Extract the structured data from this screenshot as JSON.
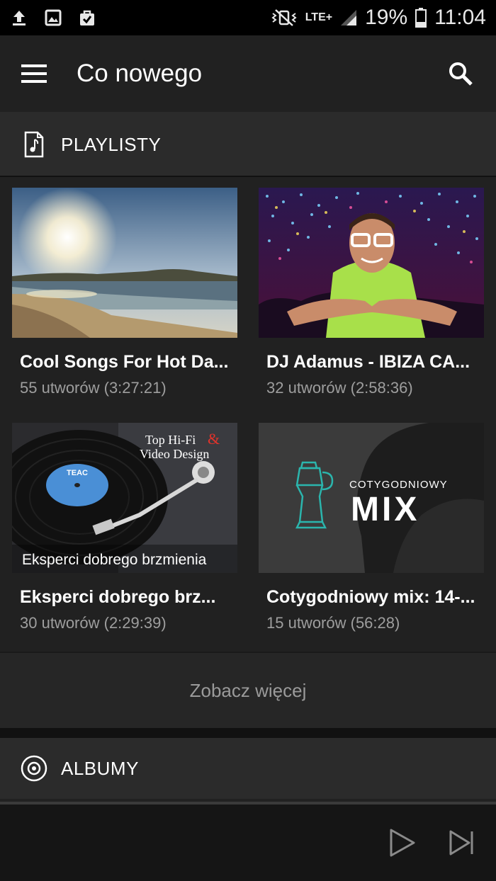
{
  "status_bar": {
    "battery": "19%",
    "time": "11:04",
    "network": "LTE+"
  },
  "toolbar": {
    "title": "Co nowego",
    "menu_icon": "hamburger-menu-icon",
    "search_icon": "search-icon"
  },
  "playlists_section": {
    "label": "PLAYLISTY",
    "icon": "music-file-icon"
  },
  "playlists": [
    {
      "title": "Cool Songs For Hot Da...",
      "subtitle": "55 utworów (3:27:21)"
    },
    {
      "title": "DJ Adamus - IBIZA CA...",
      "subtitle": "32 utworów (2:58:36)"
    },
    {
      "title": "Eksperci dobrego brz...",
      "subtitle": "30 utworów (2:29:39)",
      "cover_lines": [
        "Top Hi-Fi",
        "&",
        "Video Design",
        "Eksperci dobrego brzmienia"
      ],
      "record_label": "TEAC"
    },
    {
      "title": "Cotygodniowy mix: 14-...",
      "subtitle": "15 utworów (56:28)",
      "cover_lines": [
        "COTYGODNIOWY",
        "MIX"
      ]
    }
  ],
  "see_more": "Zobacz więcej",
  "albums_section": {
    "label": "ALBUMY",
    "icon": "album-disc-icon"
  },
  "player": {
    "play_icon": "play-icon",
    "next_icon": "skip-next-icon"
  },
  "colors": {
    "background": "#212121",
    "section_header": "#2b2b2b",
    "subtitle": "#9e9e9e"
  }
}
